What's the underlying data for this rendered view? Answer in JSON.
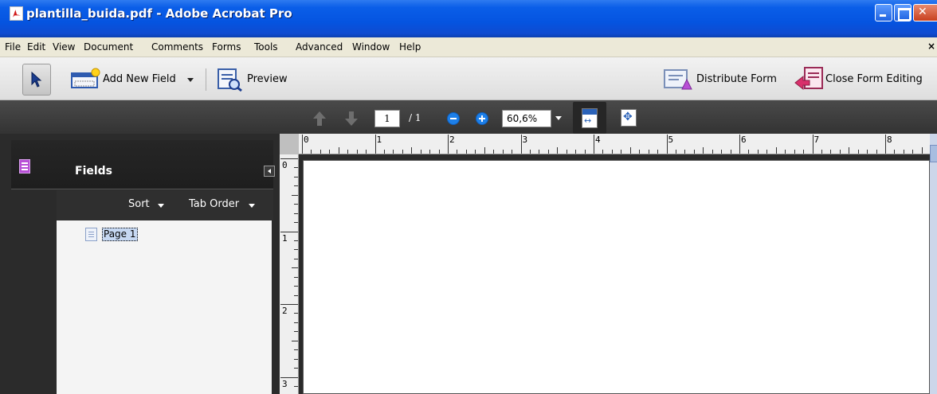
{
  "window": {
    "title": "plantilla_buida.pdf - Adobe Acrobat Pro"
  },
  "menu": {
    "items": [
      "File",
      "Edit",
      "View",
      "Document",
      "Comments",
      "Forms",
      "Tools",
      "Advanced",
      "Window",
      "Help"
    ],
    "close_glyph": "×"
  },
  "toolbar": {
    "select_tool_icon": "arrow-cursor-icon",
    "add_field_label": "Add New Field",
    "preview_label": "Preview",
    "distribute_label": "Distribute Form",
    "close_editing_label": "Close Form Editing"
  },
  "navigation": {
    "current_page": "1",
    "total_pages": "/ 1",
    "zoom": "60,6%"
  },
  "fields_panel": {
    "title": "Fields",
    "sort_label": "Sort",
    "tab_order_label": "Tab Order",
    "tree": [
      {
        "label": "Page 1"
      }
    ]
  },
  "rulers": {
    "horizontal": [
      "0",
      "1",
      "2",
      "3",
      "4",
      "5",
      "6",
      "7",
      "8"
    ],
    "vertical": [
      "0",
      "1",
      "2",
      "3"
    ]
  },
  "colors": {
    "titlebar": "#0554e0",
    "panel_dark": "#2b2b2b",
    "menu_bg": "#ece9d8",
    "zoom_blue": "#1d7fe8"
  }
}
